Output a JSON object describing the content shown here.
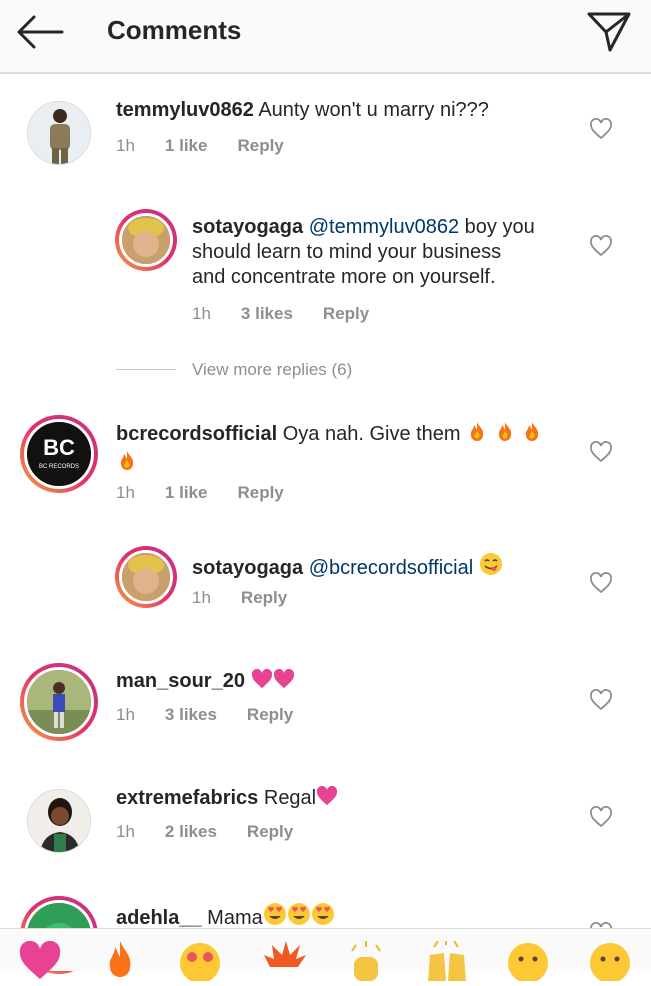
{
  "header": {
    "title": "Comments"
  },
  "comments": [
    {
      "username": "temmyluv0862",
      "text": " Aunty won't u marry ni???",
      "time": "1h",
      "likes": "1 like",
      "reply": "Reply"
    },
    {
      "username": "sotayogaga",
      "mention": "@temmyluv0862",
      "text_line1_rest": " boy you",
      "text_line2": "should learn to mind your business",
      "text_line3": "and concentrate more on yourself.",
      "time": "1h",
      "likes": "3 likes",
      "reply": "Reply"
    },
    {
      "username": "bcrecordsofficial",
      "text": " Oya nah. Give them",
      "time": "1h",
      "likes": "1 like",
      "reply": "Reply",
      "avatar_text": "BC RECORDS"
    },
    {
      "username": "sotayogaga",
      "mention": "@bcrecordsofficial",
      "time": "1h",
      "reply": "Reply"
    },
    {
      "username": "man_sour_20",
      "time": "1h",
      "likes": "3 likes",
      "reply": "Reply"
    },
    {
      "username": "extremefabrics",
      "text": " Regal",
      "time": "1h",
      "likes": "2 likes",
      "reply": "Reply"
    },
    {
      "username": "adehla__",
      "text": " Mama"
    }
  ],
  "view_more": "View more replies (6)",
  "colors": {
    "heart_pink": "#e84393",
    "mention_blue": "#00376b",
    "meta_gray": "#8e8e8e",
    "fire": "#f97316"
  },
  "emoji_bar": [
    "heart-emoji",
    "fire-emoji",
    "heart-eyes-emoji",
    "explosion-emoji",
    "clapping-emoji",
    "raised-hands-emoji",
    "smiley-emoji",
    "grin-emoji"
  ]
}
